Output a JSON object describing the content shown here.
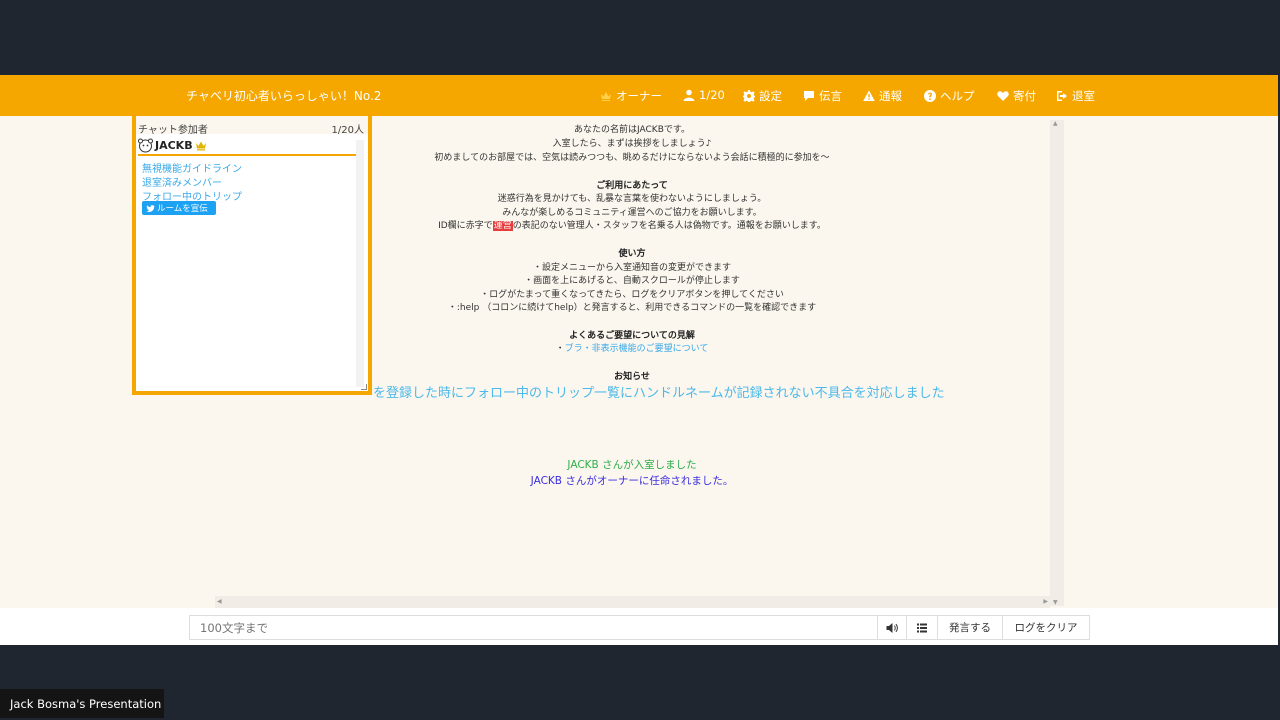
{
  "header": {
    "room_title": "チャベリ初心者いらっしゃい！No.2",
    "nav": {
      "owner": "オーナー",
      "members": "1/20",
      "settings": "設定",
      "message": "伝言",
      "report": "通報",
      "help": "ヘルプ",
      "donate": "寄付",
      "leave": "退室"
    },
    "accent_color": "#f5a700"
  },
  "members_panel": {
    "label": "チャット参加者",
    "count": "1/20人",
    "member_name": "JACKB",
    "links": [
      "無視機能ガイドライン",
      "退室済みメンバー",
      "フォロー中のトリップ"
    ],
    "promo_button": "ルームを宣伝"
  },
  "log": {
    "intro": [
      "あなたの名前はJACKBです。",
      "入室したら、まずは挨拶をしましょう♪",
      "初めましてのお部屋では、空気は読みつつも、眺めるだけにならないよう会話に積極的に参加を～"
    ],
    "usage_title": "ご利用にあたって",
    "usage": [
      "迷惑行為を見かけても、乱暴な言葉を使わないようにしましょう。",
      "みんなが楽しめるコミュニティ運営へのご協力をお願いします。"
    ],
    "id_warning_pre": "ID欄に赤字で",
    "id_warning_red": "運営",
    "id_warning_post": "の表記のない管理人・スタッフを名乗る人は偽物です。通報をお願いします。",
    "howto_title": "使い方",
    "howto": [
      "・設定メニューから入室通知音の変更ができます",
      "・画面を上にあげると、自動スクロールが停止します",
      "・ログがたまって重くなってきたら、ログをクリアボタンを押してください",
      "・:help （コロンに続けてhelp）と発言すると、利用できるコマンドの一覧を確認できます"
    ],
    "faq_title": "よくあるご要望についての見解",
    "faq_link_prefix": "・",
    "faq_link": "ブラ・非表示機能のご要望について",
    "news_title": "お知らせ",
    "news_text": "を登録した時にフォロー中のトリップ一覧にハンドルネームが記録されない不具合を対応しました",
    "enter_message": "JACKB さんが入室しました",
    "owner_message": "JACKB さんがオーナーに任命されました。"
  },
  "input_bar": {
    "placeholder": "100文字まで",
    "speak_button": "発言する",
    "clear_button": "ログをクリア"
  },
  "presenter_label": "Jack Bosma's Presentation"
}
